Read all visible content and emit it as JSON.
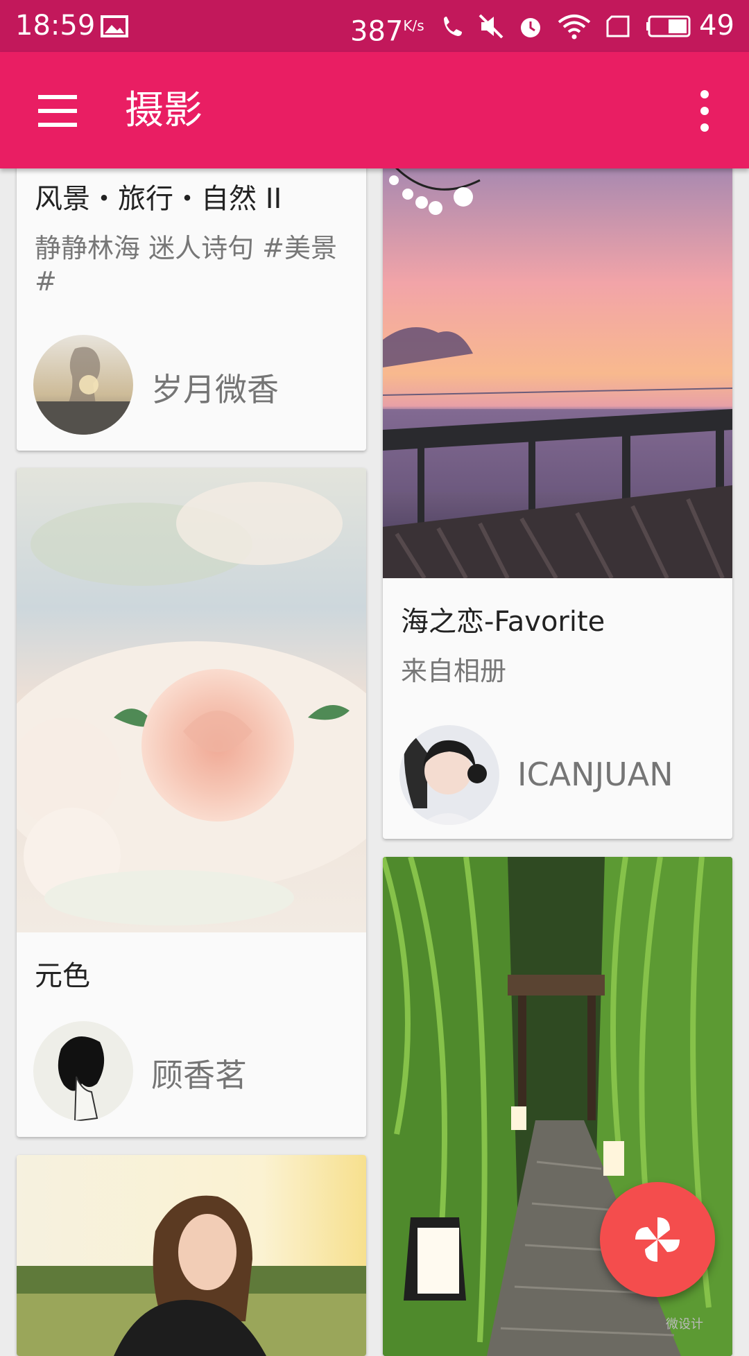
{
  "status_bar": {
    "time": "18:59",
    "speed": "387",
    "speed_unit": "K/s",
    "battery_level": "49"
  },
  "app_bar": {
    "title": "摄影",
    "menu_icon": "hamburger-menu-icon",
    "more_icon": "more-vert-icon"
  },
  "cards": [
    {
      "title": "风景・旅行・自然 II",
      "description": "静静林海 迷人诗句 #美景#",
      "author": "岁月微香"
    },
    {
      "title": "海之恋-Favorite",
      "description": "来自相册",
      "author": "ICANJUAN"
    },
    {
      "title": "元色",
      "author": "顾香茗"
    }
  ],
  "fab": {
    "icon": "pinwheel-icon"
  },
  "watermark": "微设计",
  "colors": {
    "status_bar": "#c2185b",
    "app_bar": "#e91e63",
    "fab": "#f44d4d"
  }
}
